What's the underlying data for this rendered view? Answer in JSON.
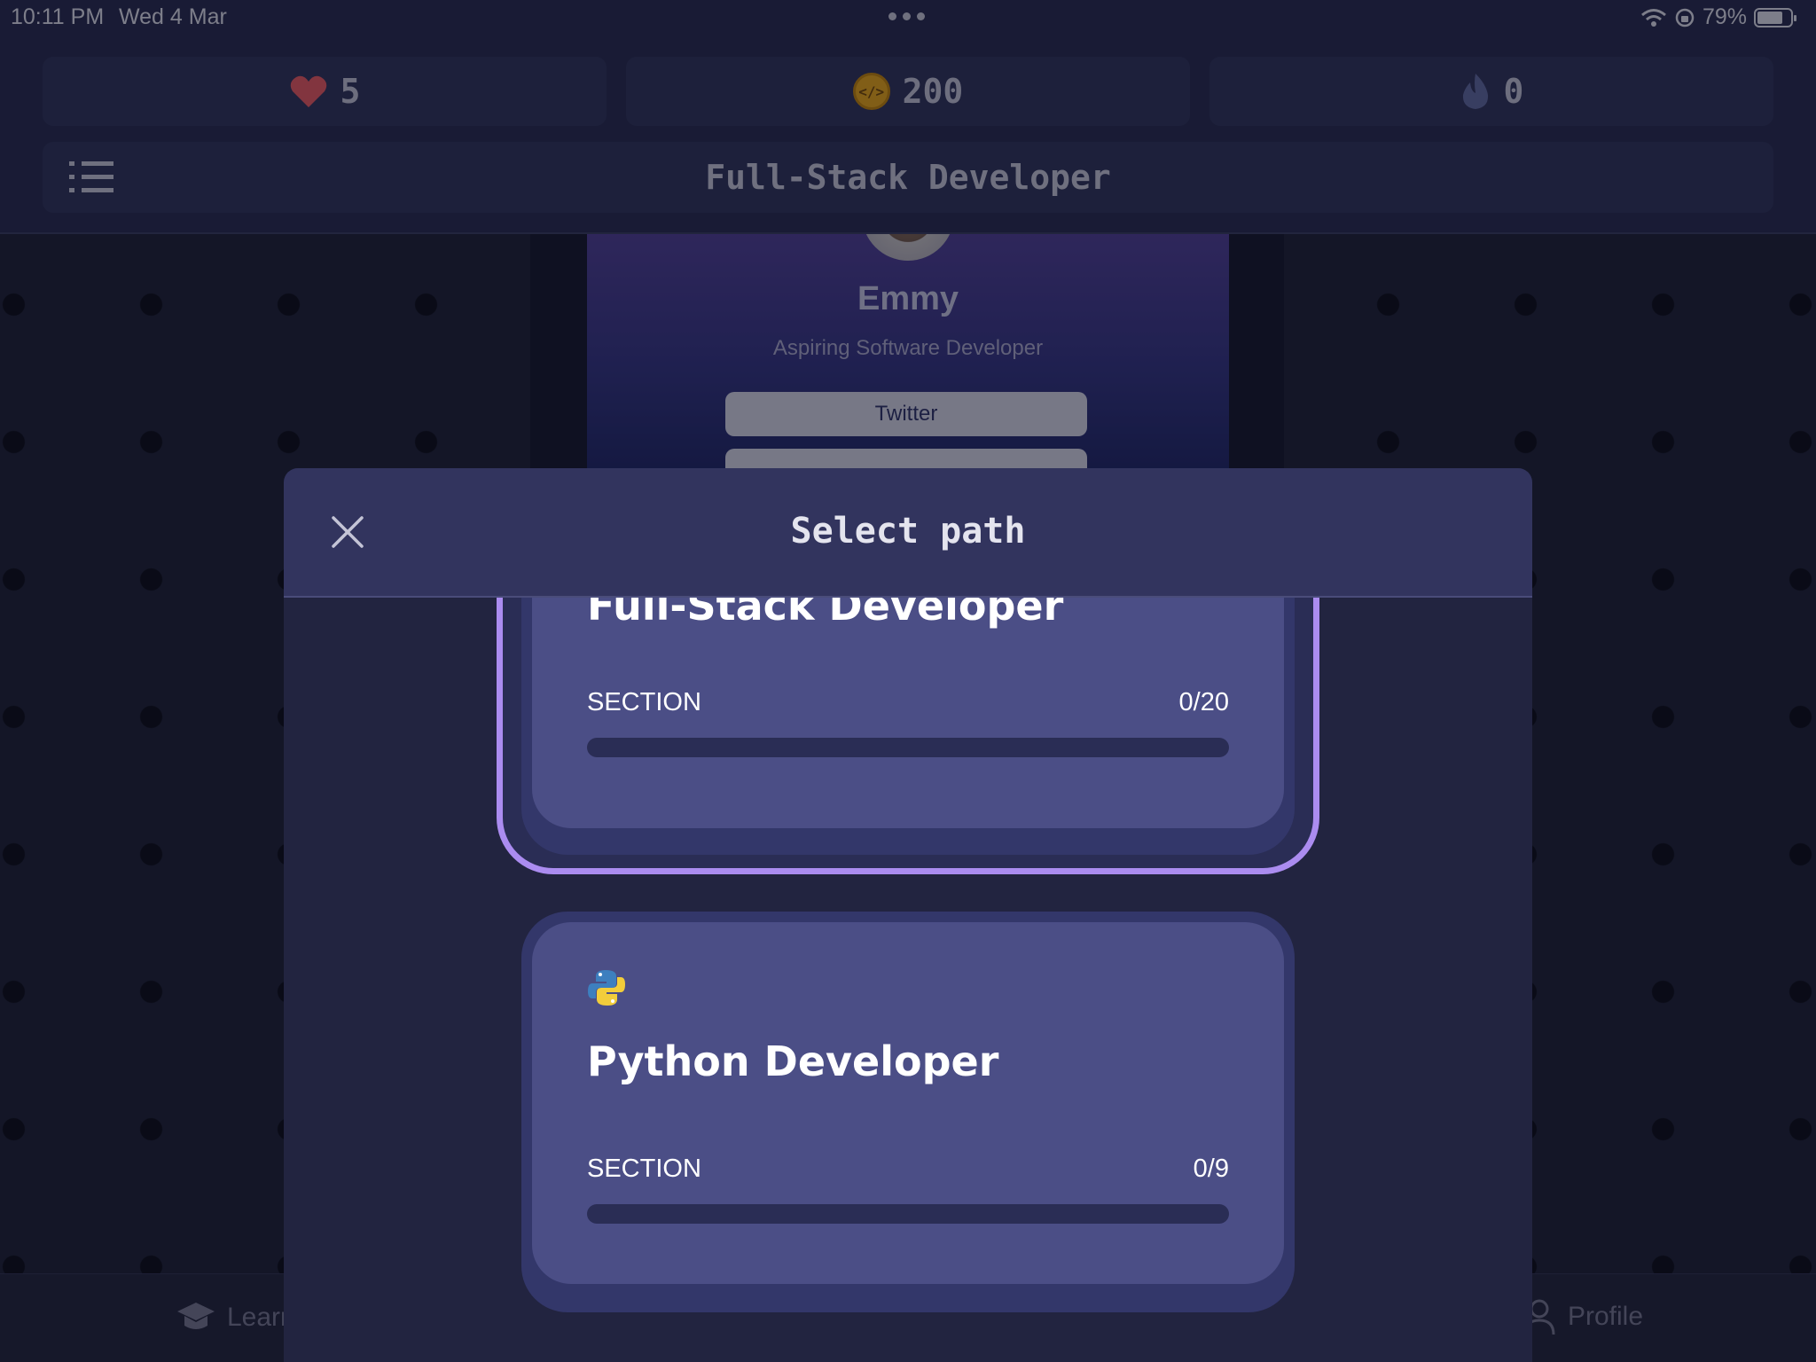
{
  "status_bar": {
    "time": "10:11 PM",
    "date": "Wed 4 Mar",
    "battery": "79%",
    "battery_level": 0.79
  },
  "header": {
    "stats": {
      "hearts": "5",
      "coins": "200",
      "streak": "0"
    },
    "title": "Full-Stack Developer"
  },
  "background_profile": {
    "name": "Emmy",
    "role": "Aspiring Software Developer",
    "link_button": "Twitter"
  },
  "bottom_nav": {
    "learn": "Learn",
    "profile": "Profile"
  },
  "modal": {
    "title": "Select path",
    "paths": [
      {
        "title": "Full-Stack Developer",
        "section_label": "SECTION",
        "section_count": "0/20",
        "progress": 0,
        "selected": true
      },
      {
        "title": "Python Developer",
        "icon": "python-icon",
        "section_label": "SECTION",
        "section_count": "0/9",
        "progress": 0,
        "selected": false
      }
    ]
  },
  "colors": {
    "accent": "#ab8cf0",
    "card": "#4b4e86",
    "header": "#25274a"
  }
}
